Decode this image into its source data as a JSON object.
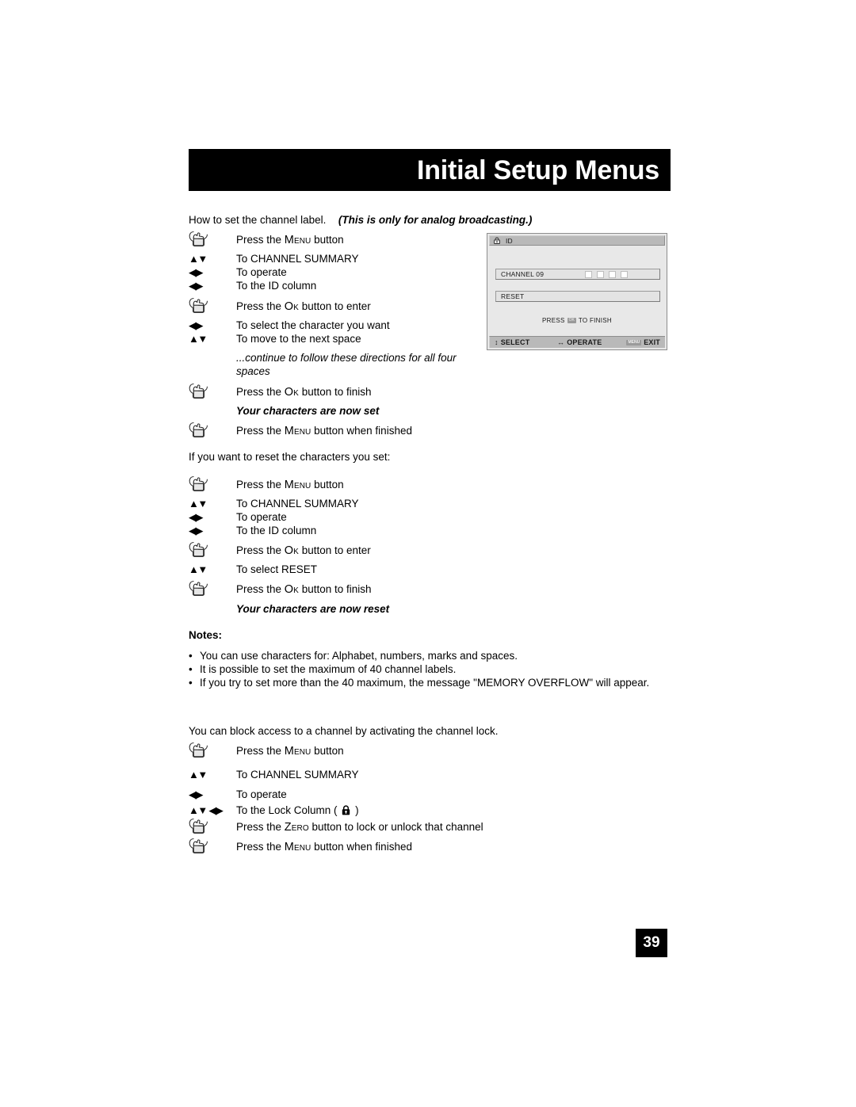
{
  "header": {
    "title": "Initial Setup Menus"
  },
  "intro": {
    "plain": "How to set the channel label.",
    "emphasis": "(This is only for analog broadcasting.)"
  },
  "section_set": {
    "steps": [
      {
        "icon": "hand-press-icon",
        "prefix": "Press the ",
        "key": "Menu",
        "suffix": " button"
      },
      {
        "icon": "arrow-up-down-icon",
        "text": "To CHANNEL SUMMARY"
      },
      {
        "icon": "arrow-left-right-icon",
        "text": "To operate"
      },
      {
        "icon": "arrow-left-right-icon",
        "text": "To the ID column"
      },
      {
        "icon": "hand-press-icon",
        "prefix": "Press the ",
        "key": "Ok",
        "suffix": " button to enter"
      },
      {
        "icon": "arrow-left-right-icon",
        "text": "To select the character you want"
      },
      {
        "icon": "arrow-up-down-icon",
        "text": "To move to the next space"
      }
    ],
    "continue_note_line1": "...continue to follow these directions for all four",
    "continue_note_line2": "spaces",
    "finish_step": {
      "prefix": "Press the ",
      "key": "Ok",
      "suffix": " button to finish"
    },
    "result_note": "Your characters are now set",
    "menu_step": {
      "prefix": "Press the ",
      "key": "Menu",
      "suffix": " button when finished"
    }
  },
  "section_reset": {
    "heading": "If you want to reset the characters you set:",
    "steps": [
      {
        "icon": "hand-press-icon",
        "prefix": "Press the ",
        "key": "Menu",
        "suffix": " button"
      },
      {
        "icon": "arrow-up-down-icon",
        "text": "To CHANNEL SUMMARY"
      },
      {
        "icon": "arrow-left-right-icon",
        "text": "To operate"
      },
      {
        "icon": "arrow-left-right-icon",
        "text": "To the ID column"
      },
      {
        "icon": "hand-press-icon",
        "prefix": "Press the ",
        "key": "Ok",
        "suffix": " button to enter"
      },
      {
        "icon": "arrow-up-down-icon",
        "text": "To select RESET"
      },
      {
        "icon": "hand-press-icon",
        "prefix": "Press the ",
        "key": "Ok",
        "suffix": " button to finish"
      }
    ],
    "result_note": "Your characters are now reset"
  },
  "notes": {
    "title": "Notes:",
    "bullet_char": "•",
    "items": [
      "You can use characters for: Alphabet, numbers, marks and spaces.",
      "It is possible to set the maximum of 40 channel labels.",
      "If you try to set more than the 40 maximum, the message \"MEMORY OVERFLOW\" will appear."
    ]
  },
  "section_lock": {
    "heading": "You can block access to a channel by activating the channel lock.",
    "steps": [
      {
        "icon": "hand-press-icon",
        "prefix": "Press the ",
        "key": "Menu",
        "suffix": " button"
      },
      {
        "icon": "arrow-up-down-icon",
        "text": "To CHANNEL SUMMARY"
      },
      {
        "icon": "arrow-left-right-icon",
        "text": "To operate"
      }
    ],
    "lock_column_step": {
      "icon": "arrow-up-down-left-right-icon",
      "prefix": "To the Lock Column ( ",
      "icon_name": "padlock-icon",
      "suffix": " )"
    },
    "zero_step": {
      "prefix": "Press the ",
      "key": "Zero",
      "suffix": " button to lock or unlock that channel"
    },
    "menu_step": {
      "prefix": "Press the ",
      "key": "Menu",
      "suffix": " button when finished"
    }
  },
  "osd": {
    "title": "ID",
    "title_icon": "padlock-icon",
    "rows": [
      {
        "label": "CHANNEL 09",
        "char_boxes": 4
      },
      {
        "label": "RESET",
        "char_boxes": 0
      }
    ],
    "hint_before": "PRESS",
    "hint_key": "OK",
    "hint_after": "TO FINISH",
    "footer": {
      "select_label": "SELECT",
      "operate_label": "OPERATE",
      "exit_key": "MENU",
      "exit_label": "EXIT"
    }
  },
  "page_number": "39",
  "colors": {
    "banner_bg": "#000000",
    "banner_text": "#ffffff",
    "osd_bg": "#e8e8e8",
    "osd_bar": "#b9b9b9",
    "page_number_bg": "#000000"
  }
}
